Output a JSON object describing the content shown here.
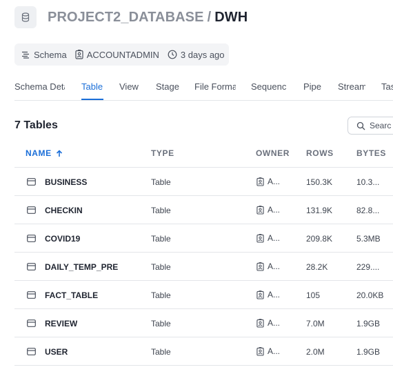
{
  "header": {
    "icon": "database-icon",
    "database": "PROJECT2_DATABASE",
    "separator": "/",
    "schema": "DWH"
  },
  "meta": {
    "kind": "Schema",
    "owner": "ACCOUNTADMIN",
    "updated": "3 days ago"
  },
  "tabs": [
    {
      "label": "Schema Deta"
    },
    {
      "label": "Table"
    },
    {
      "label": "View"
    },
    {
      "label": "Stage"
    },
    {
      "label": "File Forma"
    },
    {
      "label": "Sequenc"
    },
    {
      "label": "Pipe"
    },
    {
      "label": "Stream"
    },
    {
      "label": "Tas"
    }
  ],
  "active_tab": "Table",
  "list": {
    "count_label": "7 Tables",
    "search_label": "Searc"
  },
  "columns": {
    "name": "NAME",
    "type": "TYPE",
    "owner": "OWNER",
    "rows": "ROWS",
    "bytes": "BYTES"
  },
  "tables": [
    {
      "name": "BUSINESS",
      "type": "Table",
      "owner": "A...",
      "rows": "150.3K",
      "bytes": "10.3..."
    },
    {
      "name": "CHECKIN",
      "type": "Table",
      "owner": "A...",
      "rows": "131.9K",
      "bytes": "82.8..."
    },
    {
      "name": "COVID19",
      "type": "Table",
      "owner": "A...",
      "rows": "209.8K",
      "bytes": "5.3MB"
    },
    {
      "name": "DAILY_TEMP_PRE",
      "type": "Table",
      "owner": "A...",
      "rows": "28.2K",
      "bytes": "229...."
    },
    {
      "name": "FACT_TABLE",
      "type": "Table",
      "owner": "A...",
      "rows": "105",
      "bytes": "20.0KB"
    },
    {
      "name": "REVIEW",
      "type": "Table",
      "owner": "A...",
      "rows": "7.0M",
      "bytes": "1.9GB"
    },
    {
      "name": "USER",
      "type": "Table",
      "owner": "A...",
      "rows": "2.0M",
      "bytes": "1.9GB"
    }
  ],
  "colors": {
    "accent": "#1a6ed8",
    "muted_title": "#8a8f99",
    "border": "#e3e5e9"
  }
}
